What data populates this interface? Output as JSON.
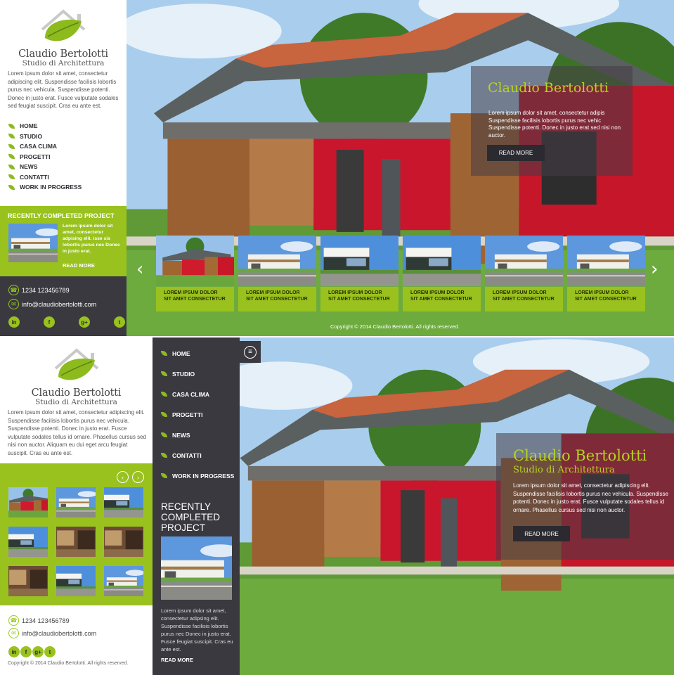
{
  "brand": {
    "name": "Claudio Bertolotti",
    "subtitle": "Studio di Architettura"
  },
  "colors": {
    "accent": "#99c21f",
    "dark": "#3a393f",
    "accent_text": "#b8d31f"
  },
  "p1": {
    "intro": "Lorem ipsum dolor sit amet, consectetur adipiscing elit. Suspendisse facilisis lobortis purus nec vehicula. Suspendisse potenti. Donec in justo erat. Fusce vulputate sodales sed feugiat suscipit. Cras eu ante est.",
    "nav": [
      "HOME",
      "STUDIO",
      "CASA CLIMA",
      "PROGETTI",
      "NEWS",
      "CONTATTI",
      "WORK IN PROGRESS"
    ],
    "recent": {
      "title": "RECENTLY COMPLETED PROJECT",
      "text": "Lorem ipsum dolor sit amet, consectetur adpising elit. isse sis lobortis purus nec Donec in justo erat.",
      "more": "READ MORE"
    },
    "phone": "1234 123456789",
    "email": "info@claudiobertolotti.com",
    "social": [
      "in",
      "f",
      "g+",
      "t"
    ],
    "hero": {
      "title": "Claudio Bertolotti",
      "text": "Lorem ipsum dolor sit amet, consectetur adipis Suspendisse facilisis lobortis purus nec vehic Suspendisse potenti. Donec in justo erat sed nisi non auctor.",
      "button": "READ MORE"
    },
    "captions": [
      "LOREM IPSUM DOLOR SIT AMET CONSECTETUR",
      "LOREM IPSUM DOLOR SIT AMET CONSECTETUR",
      "LOREM IPSUM DOLOR SIT AMET CONSECTETUR",
      "LOREM IPSUM DOLOR SIT AMET CONSECTETUR",
      "LOREM IPSUM DOLOR SIT AMET CONSECTETUR",
      "LOREM IPSUM DOLOR SIT AMET CONSECTETUR"
    ],
    "prev_icon": "chevron-left-icon",
    "next_icon": "chevron-right-icon",
    "copyright": "Copyright © 2014 Claudio Bertolotti. All rights reserved."
  },
  "p2": {
    "intro": "Lorem ipsum dolor sit amet, consectetur adipiscing elit. Suspendisse facilisis lobortis purus nec vehicula. Suspendisse potenti. Donec in justo erat. Fusce vulputate sodales tellus id ornare. Phasellus cursus sed nisi non auctor. Aliquam eu dui eget arcu feugiat suscipit. Cras eu ante est.",
    "nav": [
      "HOME",
      "STUDIO",
      "CASA CLIMA",
      "PROGETTI",
      "NEWS",
      "CONTATTI",
      "WORK IN PROGRESS"
    ],
    "menu_icon": "menu-icon",
    "recent": {
      "title": "RECENTLY COMPLETED PROJECT",
      "text": "Lorem ipsum dolor sit amet, consectetur adipsing elit. Suspendisse facilisis lobortis purus nec Donec in justo erat. Fusce  feugiat suscipit. Cras eu ante est.",
      "more": "READ MORE"
    },
    "hero": {
      "title": "Claudio Bertolotti",
      "subtitle": "Studio di Architettura",
      "text": "Lorem ipsum dolor sit amet, consectetur adipiscing elit. Suspendisse facilisis lobortis purus nec vehicula. Suspendisse potenti. Donec in justo erat. Fusce  vulputate sodales tellus id ornare. Phasellus cursus sed nisi non auctor.",
      "button": "READ MORE"
    },
    "phone": "1234 123456789",
    "email": "info@claudiobertolotti.com",
    "social": [
      "in",
      "f",
      "g+",
      "t"
    ],
    "copyright": "Copyright © 2014 Claudio Bertolotti. All rights reserved."
  }
}
